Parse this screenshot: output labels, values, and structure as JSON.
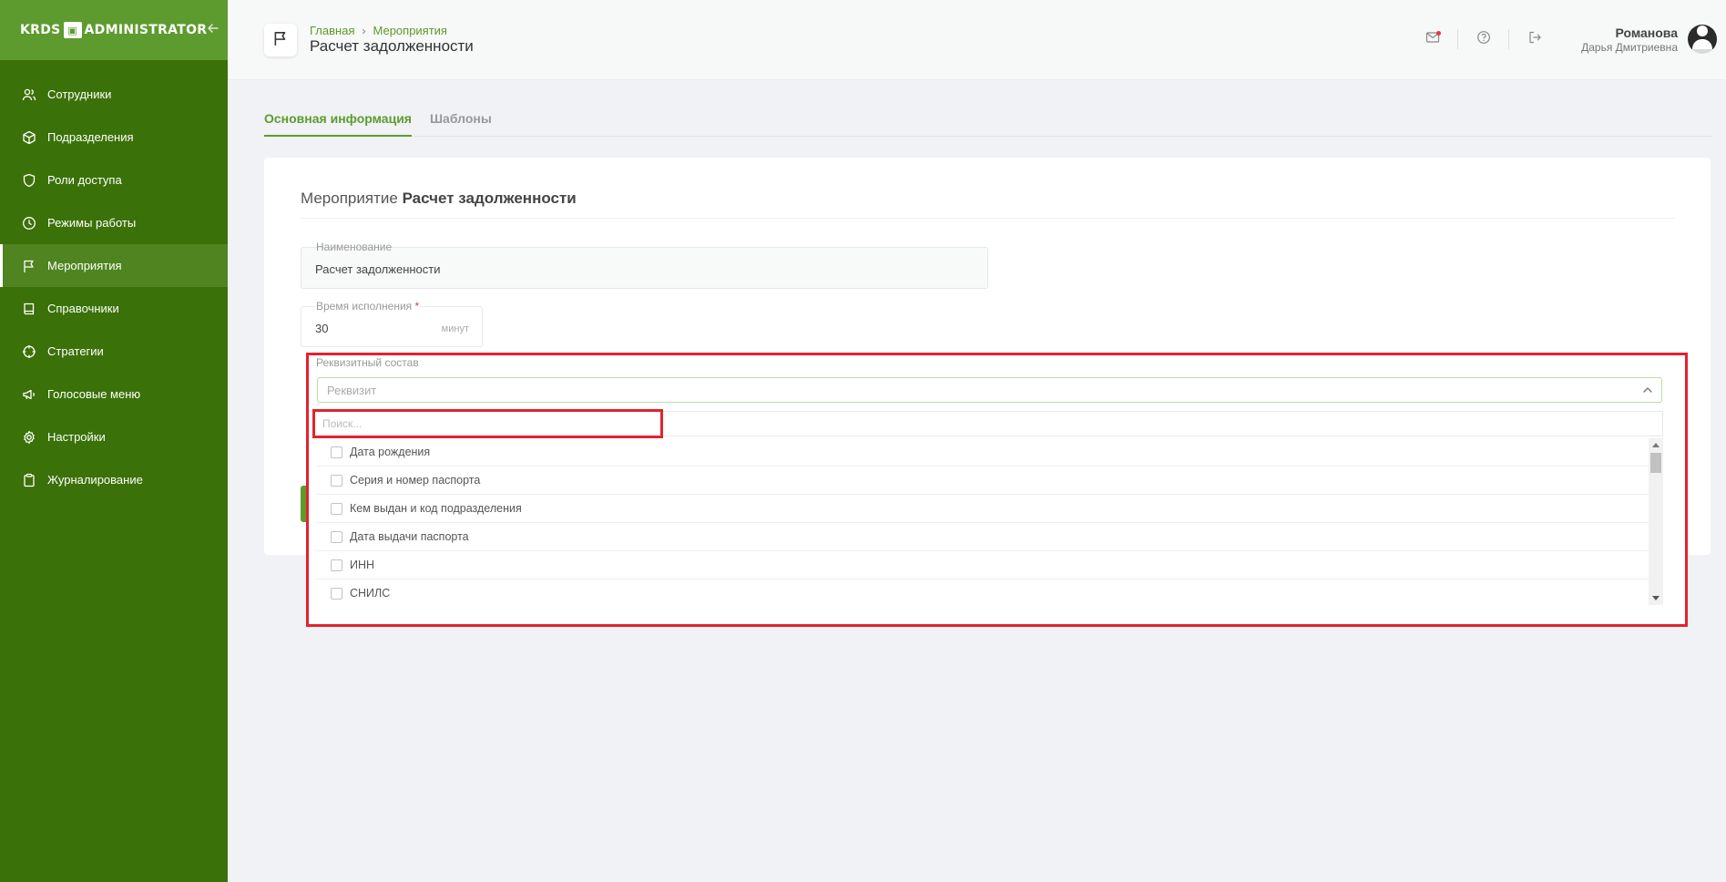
{
  "sidebar": {
    "logo_left": "KRDS",
    "logo_mark": "▣",
    "logo_right": "ADMINISTRATOR",
    "items": [
      {
        "label": "Сотрудники",
        "icon": "users-icon"
      },
      {
        "label": "Подразделения",
        "icon": "cube-icon"
      },
      {
        "label": "Роли доступа",
        "icon": "shield-icon"
      },
      {
        "label": "Режимы работы",
        "icon": "clock-icon"
      },
      {
        "label": "Мероприятия",
        "icon": "flag-icon",
        "active": true
      },
      {
        "label": "Справочники",
        "icon": "book-icon"
      },
      {
        "label": "Стратегии",
        "icon": "crosshair-icon"
      },
      {
        "label": "Голосовые меню",
        "icon": "megaphone-icon"
      },
      {
        "label": "Настройки",
        "icon": "gear-icon"
      },
      {
        "label": "Журналирование",
        "icon": "clipboard-icon"
      }
    ]
  },
  "header": {
    "breadcrumb": [
      "Главная",
      "Мероприятия"
    ],
    "breadcrumb_sep": "›",
    "title": "Расчет задолженности",
    "user": {
      "last_name": "Романова",
      "full_name": "Дарья Дмитриевна"
    }
  },
  "tabs": [
    {
      "label": "Основная информация",
      "active": true
    },
    {
      "label": "Шаблоны",
      "active": false
    }
  ],
  "card": {
    "title_prefix": "Мероприятие",
    "title_name": "Расчет задолженности",
    "name_field": {
      "label": "Наименование",
      "value": "Расчет задолженности"
    },
    "time_field": {
      "label": "Время исполнения",
      "required_mark": "*",
      "value": "30",
      "unit": "минут"
    }
  },
  "requisites": {
    "label": "Реквизитный состав",
    "select_placeholder": "Реквизит",
    "search_placeholder": "Поиск...",
    "options": [
      "Дата рождения",
      "Серия и номер паспорта",
      "Кем выдан и код подразделения",
      "Дата выдачи паспорта",
      "ИНН",
      "СНИЛС"
    ]
  },
  "colors": {
    "sidebar_bg": "#3a7109",
    "accent": "#5d9b2e",
    "highlight": "#e3222e"
  }
}
